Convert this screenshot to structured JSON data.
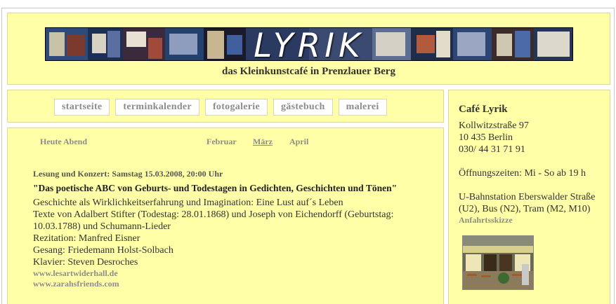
{
  "header": {
    "banner_title": "LYRIK",
    "subtitle": "das Kleinkunstcafé in Prenzlauer Berg"
  },
  "nav": {
    "items": [
      "startseite",
      "terminkalender",
      "fotogalerie",
      "gästebuch",
      "malerei"
    ]
  },
  "calendar": {
    "today_label": "Heute Abend",
    "months": [
      "Februar",
      "März",
      "April"
    ],
    "active_month": "März"
  },
  "event": {
    "date_line": "Lesung und Konzert: Samstag 15.03.2008, 20:00 Uhr",
    "title": "\"Das poetische ABC von Geburts- und Todestagen in Gedichten, Geschichten und Tönen\"",
    "lines": [
      "Geschichte als Wirklichkeitserfahrung und Imagination: Eine Lust auf´s Leben",
      "Texte von Adalbert Stifter (Todestag: 28.01.1868) und Joseph von Eichendorff (Geburtstag: 10.03.1788) und Schumann-Lieder",
      "Rezitation: Manfred Eisner",
      "Gesang: Friedemann Holst-Solbach",
      "Klavier: Steven Desroches"
    ],
    "links": [
      "www.lesartwiderhall.de",
      "www.zarahsfriends.com"
    ]
  },
  "sidebar": {
    "title": "Café Lyrik",
    "address": [
      "Kollwitzstraße 97",
      "10 435 Berlin",
      "030/ 44 31 71 91"
    ],
    "hours": "Öffnungszeiten: Mi - So ab 19 h",
    "transit": [
      "U-Bahnstation Eberswalder Straße",
      "(U2), Bus (N2), Tram (M2, M10)"
    ],
    "directions_link": "Anfahrtsskizze"
  },
  "colors": {
    "panel_bg": "#ffffa8",
    "link_gray": "#8c8c8c"
  }
}
